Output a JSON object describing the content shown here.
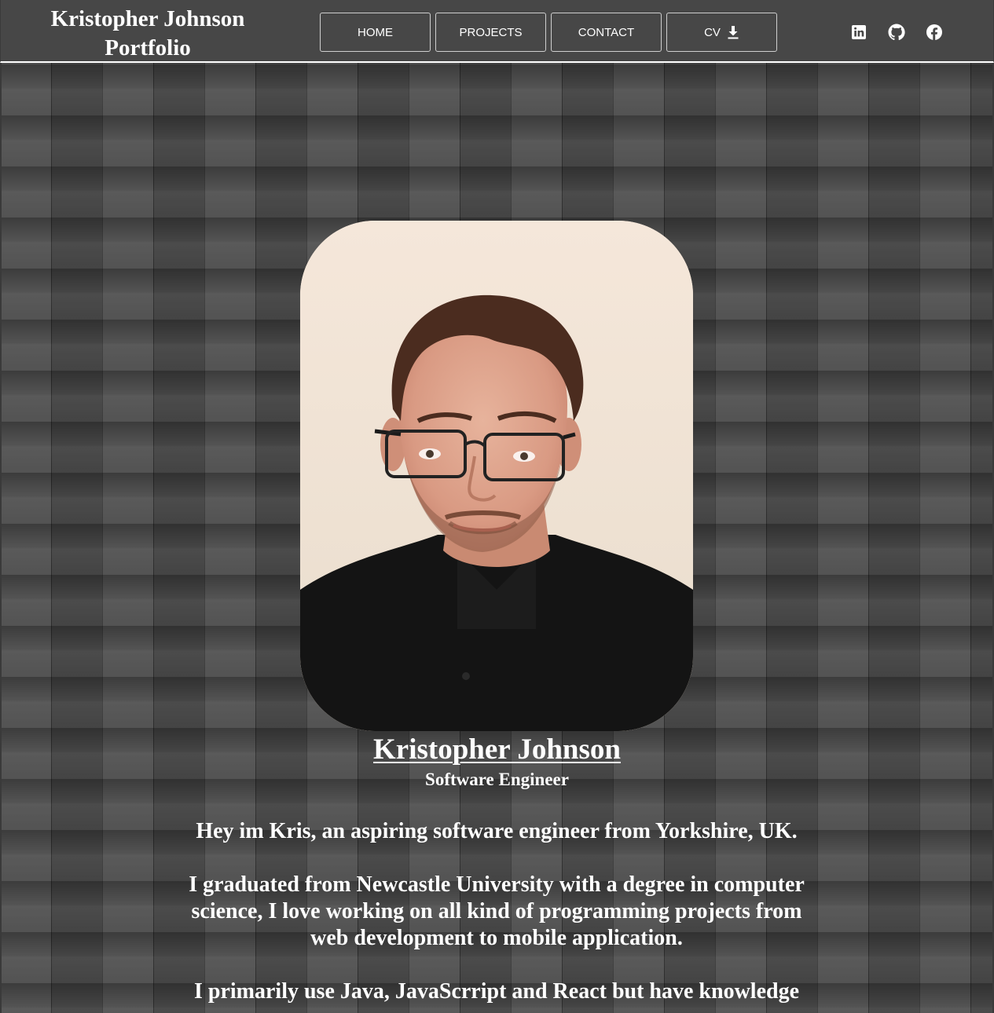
{
  "header": {
    "brand_line1": "Kristopher Johnson",
    "brand_line2": "Portfolio"
  },
  "nav": {
    "items": [
      {
        "label": "HOME"
      },
      {
        "label": "PROJECTS"
      },
      {
        "label": "CONTACT"
      },
      {
        "label": "CV",
        "icon": "download-icon"
      }
    ]
  },
  "socials": [
    {
      "icon": "linkedin-icon"
    },
    {
      "icon": "github-icon"
    },
    {
      "icon": "facebook-icon"
    }
  ],
  "hero": {
    "name": "Kristopher Johnson",
    "role": "Software Engineer"
  },
  "bio": {
    "p1": "Hey im Kris, an aspiring software engineer from Yorkshire, UK.",
    "p2": "I graduated from Newcastle University with a degree in computer science, I love working on all kind of programming projects from web development to mobile application.",
    "p3": "I primarily use Java, JavaScrript and React but have knowledge"
  },
  "colors": {
    "header_bg": "#474747",
    "page_bg": "#4a4a4a",
    "text": "#ffffff"
  }
}
